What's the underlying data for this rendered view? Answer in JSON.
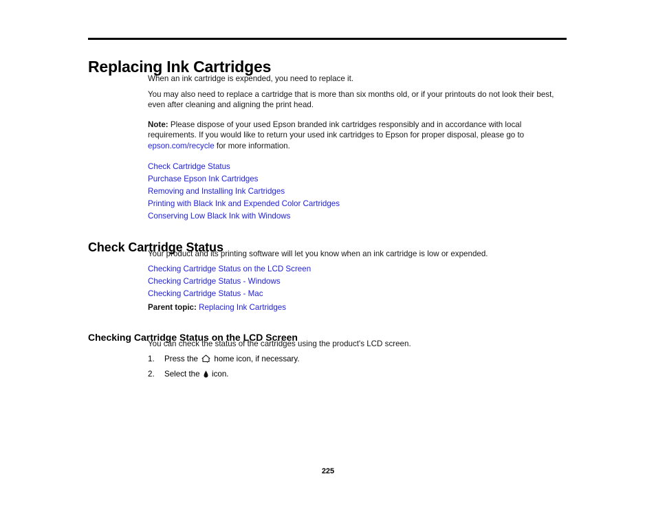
{
  "document": {
    "title": "Replacing Ink Cartridges",
    "page_number": "225",
    "link_color": "#2020dd",
    "rule_color": "#000000"
  },
  "intro": {
    "paragraph_1": "When an ink cartridge is expended, you need to replace it.",
    "paragraph_2": "You may also need to replace a cartridge that is more than six months old, or if your printouts do not look their best, even after cleaning and aligning the print head.",
    "note": {
      "label": "Note:",
      "text_before_link": " Please dispose of your used Epson branded ink cartridges responsibly and in accordance with local requirements. If you would like to return your used ink cartridges to Epson for proper disposal, please go to ",
      "link_text": "epson.com/recycle",
      "text_after_link": " for more information."
    }
  },
  "topic_links": [
    {
      "label": "Check Cartridge Status"
    },
    {
      "label": "Purchase Epson Ink Cartridges"
    },
    {
      "label": "Removing and Installing Ink Cartridges"
    },
    {
      "label": "Printing with Black Ink and Expended Color Cartridges"
    },
    {
      "label": "Conserving Low Black Ink with Windows"
    }
  ],
  "section_check_status": {
    "heading": "Check Cartridge Status",
    "paragraph": "Your product and its printing software will let you know when an ink cartridge is low or expended.",
    "links": [
      {
        "label": "Checking Cartridge Status on the LCD Screen"
      },
      {
        "label": "Checking Cartridge Status - Windows"
      },
      {
        "label": "Checking Cartridge Status - Mac"
      }
    ],
    "parent_topic": {
      "label": "Parent topic:",
      "link_text": "Replacing Ink Cartridges"
    }
  },
  "section_lcd": {
    "heading": "Checking Cartridge Status on the LCD Screen",
    "paragraph": "You can check the status of the cartridges using the product's LCD screen.",
    "steps": [
      {
        "number": "1.",
        "text_before_icon": "Press the ",
        "icon": "home-icon",
        "text_after_icon": " home icon, if necessary."
      },
      {
        "number": "2.",
        "text_before_icon": "Select the ",
        "icon": "ink-drop-icon",
        "text_after_icon": " icon."
      }
    ]
  }
}
